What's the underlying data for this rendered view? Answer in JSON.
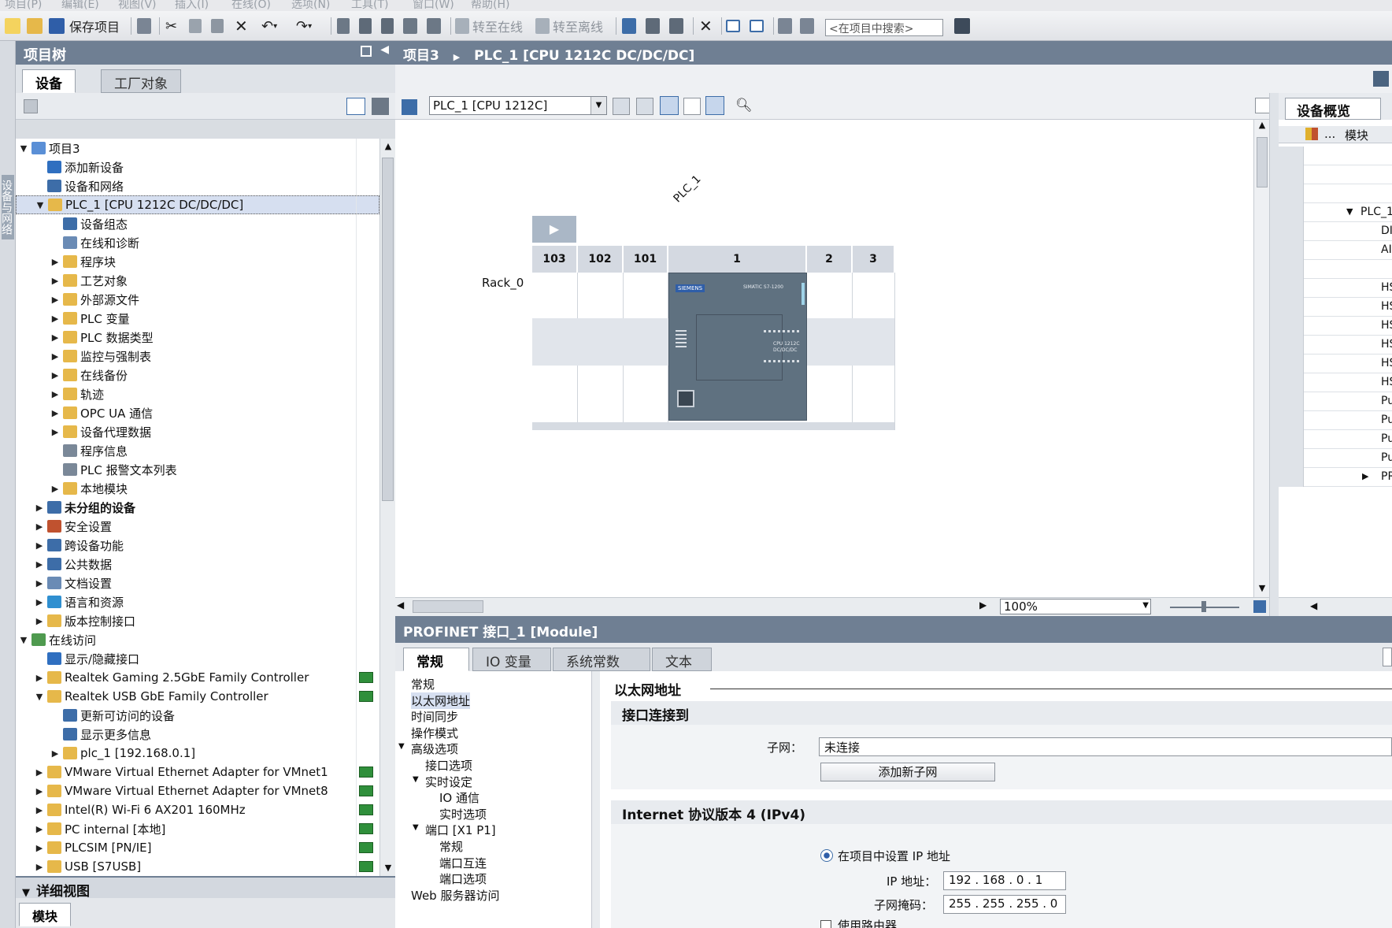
{
  "menu": [
    "项目(P)",
    "编辑(E)",
    "视图(V)",
    "插入(I)",
    "在线(O)",
    "选项(N)",
    "工具(T)",
    "窗口(W)",
    "帮助(H)"
  ],
  "toolbar": {
    "save_label": "保存项目",
    "go_online": "转至在线",
    "go_offline": "转至离线",
    "search_placeholder": "<在项目中搜索>"
  },
  "left_strip": {
    "label": "设备与网络"
  },
  "project_tree": {
    "title": "项目树",
    "tabs": [
      "设备",
      "工厂对象"
    ],
    "items": [
      {
        "label": "项目3",
        "level": 0,
        "arrow": "▼",
        "icon": "#5a8fd6"
      },
      {
        "label": "添加新设备",
        "level": 1,
        "arrow": "",
        "icon": "#2f6fc0"
      },
      {
        "label": "设备和网络",
        "level": 1,
        "arrow": "",
        "icon": "#3d6da8"
      },
      {
        "label": "PLC_1 [CPU 1212C DC/DC/DC]",
        "level": 1,
        "arrow": "▼",
        "icon": "#e6b84a",
        "selected": true
      },
      {
        "label": "设备组态",
        "level": 2,
        "arrow": "",
        "icon": "#3d6da8"
      },
      {
        "label": "在线和诊断",
        "level": 2,
        "arrow": "",
        "icon": "#6a8bb5"
      },
      {
        "label": "程序块",
        "level": 2,
        "arrow": "▶",
        "icon": "#e6b84a"
      },
      {
        "label": "工艺对象",
        "level": 2,
        "arrow": "▶",
        "icon": "#e6b84a"
      },
      {
        "label": "外部源文件",
        "level": 2,
        "arrow": "▶",
        "icon": "#e6b84a"
      },
      {
        "label": "PLC 变量",
        "level": 2,
        "arrow": "▶",
        "icon": "#e6b84a"
      },
      {
        "label": "PLC 数据类型",
        "level": 2,
        "arrow": "▶",
        "icon": "#e6b84a"
      },
      {
        "label": "监控与强制表",
        "level": 2,
        "arrow": "▶",
        "icon": "#e6b84a"
      },
      {
        "label": "在线备份",
        "level": 2,
        "arrow": "▶",
        "icon": "#e6b84a"
      },
      {
        "label": "轨迹",
        "level": 2,
        "arrow": "▶",
        "icon": "#e6b84a"
      },
      {
        "label": "OPC UA 通信",
        "level": 2,
        "arrow": "▶",
        "icon": "#e6b84a"
      },
      {
        "label": "设备代理数据",
        "level": 2,
        "arrow": "▶",
        "icon": "#e6b84a"
      },
      {
        "label": "程序信息",
        "level": 2,
        "arrow": "",
        "icon": "#7a8898"
      },
      {
        "label": "PLC 报警文本列表",
        "level": 2,
        "arrow": "",
        "icon": "#7a8898"
      },
      {
        "label": "本地模块",
        "level": 2,
        "arrow": "▶",
        "icon": "#e6b84a"
      },
      {
        "label": "未分组的设备",
        "level": 1,
        "arrow": "▶",
        "icon": "#3d6da8",
        "bold": true
      },
      {
        "label": "安全设置",
        "level": 1,
        "arrow": "▶",
        "icon": "#c0522f"
      },
      {
        "label": "跨设备功能",
        "level": 1,
        "arrow": "▶",
        "icon": "#3d6da8"
      },
      {
        "label": "公共数据",
        "level": 1,
        "arrow": "▶",
        "icon": "#3d6da8"
      },
      {
        "label": "文档设置",
        "level": 1,
        "arrow": "▶",
        "icon": "#6a8bb5"
      },
      {
        "label": "语言和资源",
        "level": 1,
        "arrow": "▶",
        "icon": "#2f8fd0"
      },
      {
        "label": "版本控制接口",
        "level": 1,
        "arrow": "▶",
        "icon": "#e6b84a"
      },
      {
        "label": "在线访问",
        "level": 0,
        "arrow": "▼",
        "icon": "#4f9a4f"
      },
      {
        "label": "显示/隐藏接口",
        "level": 1,
        "arrow": "",
        "icon": "#2f6fc0"
      },
      {
        "label": "Realtek Gaming 2.5GbE Family Controller",
        "level": 1,
        "arrow": "▶",
        "icon": "#e6b84a",
        "status": true
      },
      {
        "label": "Realtek USB GbE Family Controller",
        "level": 1,
        "arrow": "▼",
        "icon": "#e6b84a",
        "status": true
      },
      {
        "label": "更新可访问的设备",
        "level": 2,
        "arrow": "",
        "icon": "#3d6da8"
      },
      {
        "label": "显示更多信息",
        "level": 2,
        "arrow": "",
        "icon": "#3d6da8"
      },
      {
        "label": "plc_1 [192.168.0.1]",
        "level": 2,
        "arrow": "▶",
        "icon": "#e6b84a"
      },
      {
        "label": "VMware Virtual Ethernet Adapter for VMnet1",
        "level": 1,
        "arrow": "▶",
        "icon": "#e6b84a",
        "status": true
      },
      {
        "label": "VMware Virtual Ethernet Adapter for VMnet8",
        "level": 1,
        "arrow": "▶",
        "icon": "#e6b84a",
        "status": true
      },
      {
        "label": "Intel(R) Wi-Fi 6 AX201 160MHz",
        "level": 1,
        "arrow": "▶",
        "icon": "#e6b84a",
        "status": true
      },
      {
        "label": "PC internal [本地]",
        "level": 1,
        "arrow": "▶",
        "icon": "#e6b84a",
        "status": true
      },
      {
        "label": "PLCSIM [PN/IE]",
        "level": 1,
        "arrow": "▶",
        "icon": "#e6b84a",
        "status": true
      },
      {
        "label": "USB [S7USB]",
        "level": 1,
        "arrow": "▶",
        "icon": "#e6b84a",
        "status": true
      }
    ],
    "detail_title": "详细视图",
    "detail_tab": "模块"
  },
  "breadcrumb": {
    "project": "项目3",
    "sep": "▶",
    "device": "PLC_1 [CPU 1212C DC/DC/DC]"
  },
  "device_view": {
    "device_select": "PLC_1 [CPU 1212C]",
    "plc_label": "PLC_1",
    "rack_label": "Rack_0",
    "slots": [
      "103",
      "102",
      "101",
      "1",
      "2",
      "3"
    ],
    "cpu_brand": "SIEMENS",
    "cpu_family": "SIMATIC S7-1200",
    "cpu_model": "CPU 1212C DC/DC/DC",
    "zoom": "100%"
  },
  "overview": {
    "title": "设备概览",
    "col_dots": "...",
    "col_module": "模块",
    "rows": [
      "",
      "",
      "",
      "PLC_1",
      "DI",
      "AI",
      "",
      "HS",
      "HS",
      "HS",
      "HS",
      "HS",
      "HS",
      "Pu",
      "Pu",
      "Pu",
      "Pu",
      "PR"
    ]
  },
  "inspector": {
    "title": "PROFINET 接口_1 [Module]",
    "tabs": [
      "常规",
      "IO 变量",
      "系统常数",
      "文本"
    ],
    "nav": [
      {
        "label": "常规",
        "level": 0,
        "arrow": ""
      },
      {
        "label": "以太网地址",
        "level": 0,
        "arrow": "",
        "selected": true
      },
      {
        "label": "时间同步",
        "level": 0,
        "arrow": ""
      },
      {
        "label": "操作模式",
        "level": 0,
        "arrow": ""
      },
      {
        "label": "高级选项",
        "level": 0,
        "arrow": "▼"
      },
      {
        "label": "接口选项",
        "level": 1,
        "arrow": ""
      },
      {
        "label": "实时设定",
        "level": 1,
        "arrow": "▼"
      },
      {
        "label": "IO 通信",
        "level": 2,
        "arrow": ""
      },
      {
        "label": "实时选项",
        "level": 2,
        "arrow": ""
      },
      {
        "label": "端口 [X1 P1]",
        "level": 1,
        "arrow": "▼"
      },
      {
        "label": "常规",
        "level": 2,
        "arrow": ""
      },
      {
        "label": "端口互连",
        "level": 2,
        "arrow": ""
      },
      {
        "label": "端口选项",
        "level": 2,
        "arrow": ""
      },
      {
        "label": "Web 服务器访问",
        "level": 0,
        "arrow": ""
      }
    ],
    "section_title": "以太网地址",
    "connected_title": "接口连接到",
    "subnet_label": "子网：",
    "subnet_value": "未连接",
    "add_subnet_button": "添加新子网",
    "ipv4_title": "Internet 协议版本 4 (IPv4)",
    "set_ip_option": "在项目中设置 IP 地址",
    "ip_label": "IP 地址：",
    "ip_value": "192 . 168 . 0    . 1",
    "mask_label": "子网掩码：",
    "mask_value": "255 . 255 . 255 . 0",
    "router_label": "使用路由器"
  }
}
